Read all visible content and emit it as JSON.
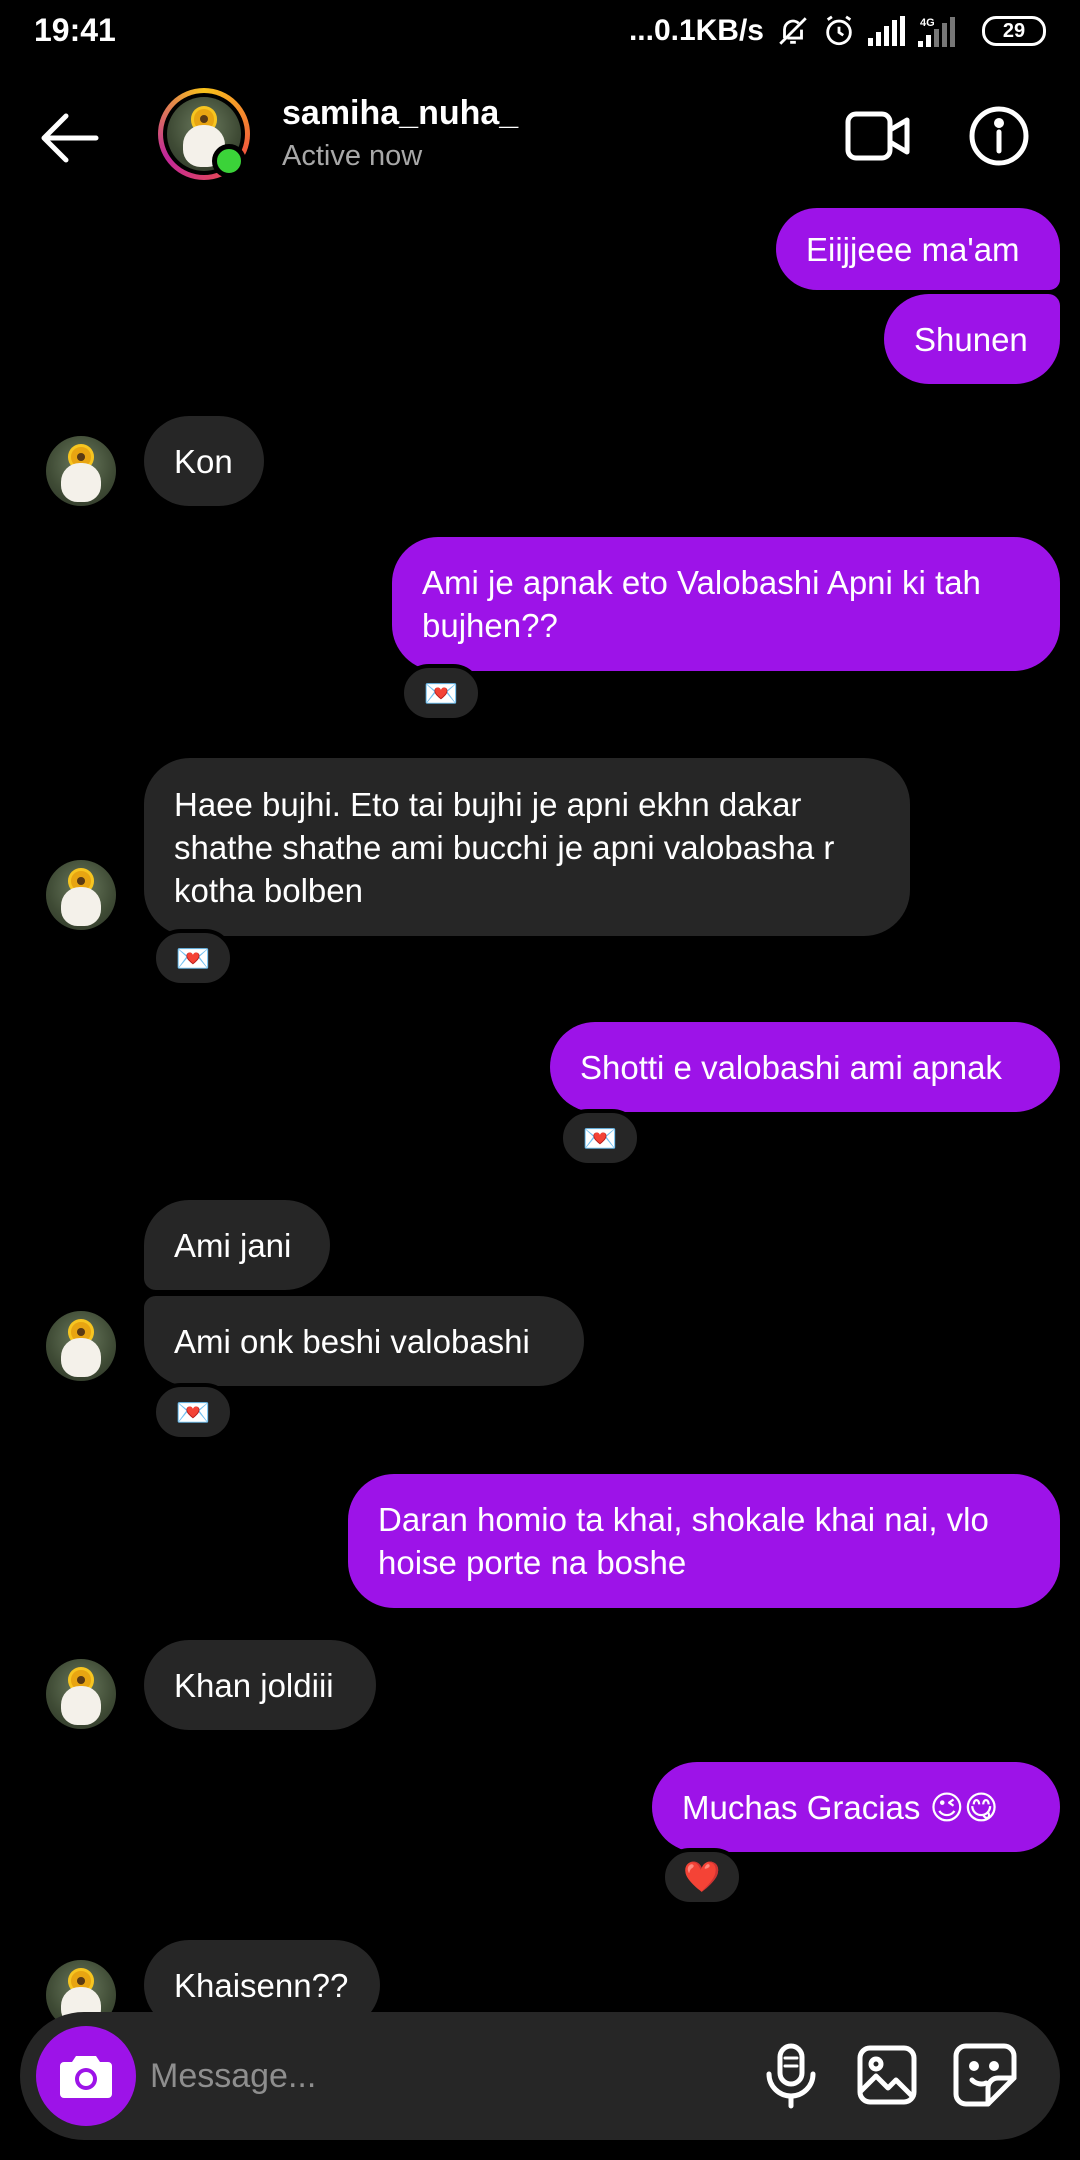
{
  "status_bar": {
    "time": "19:41",
    "net_speed": "...0.1KB/s",
    "network": "4G",
    "battery": "29"
  },
  "header": {
    "username": "samiha_nuha_",
    "status": "Active now"
  },
  "messages": [
    {
      "from": "me",
      "text": "Eiijjeee ma'am"
    },
    {
      "from": "me",
      "text": "Shunen"
    },
    {
      "from": "them",
      "text": "Kon"
    },
    {
      "from": "me",
      "text": "Ami je apnak eto Valobashi Apni ki tah bujhen??",
      "reaction": "💌"
    },
    {
      "from": "them",
      "text": "Haee bujhi. Eto tai bujhi je apni ekhn dakar shathe shathe ami bucchi je apni valobasha r kotha bolben",
      "reaction": "💌"
    },
    {
      "from": "me",
      "text": "Shotti e valobashi ami apnak",
      "reaction": "💌"
    },
    {
      "from": "them",
      "text": "Ami jani"
    },
    {
      "from": "them",
      "text": "Ami onk beshi valobashi",
      "reaction": "💌"
    },
    {
      "from": "me",
      "text": "Daran homio ta khai, shokale khai nai, vlo hoise porte na boshe"
    },
    {
      "from": "them",
      "text": "Khan joldiii"
    },
    {
      "from": "me",
      "text": "Muchas Gracias 😉😋",
      "reaction": "❤️"
    },
    {
      "from": "them",
      "text": "Khaisenn??"
    }
  ],
  "composer": {
    "placeholder": "Message..."
  },
  "colors": {
    "sent_bubble": "#9d13e8",
    "received_bubble": "#262626",
    "background": "#000000",
    "online": "#3bd339"
  }
}
